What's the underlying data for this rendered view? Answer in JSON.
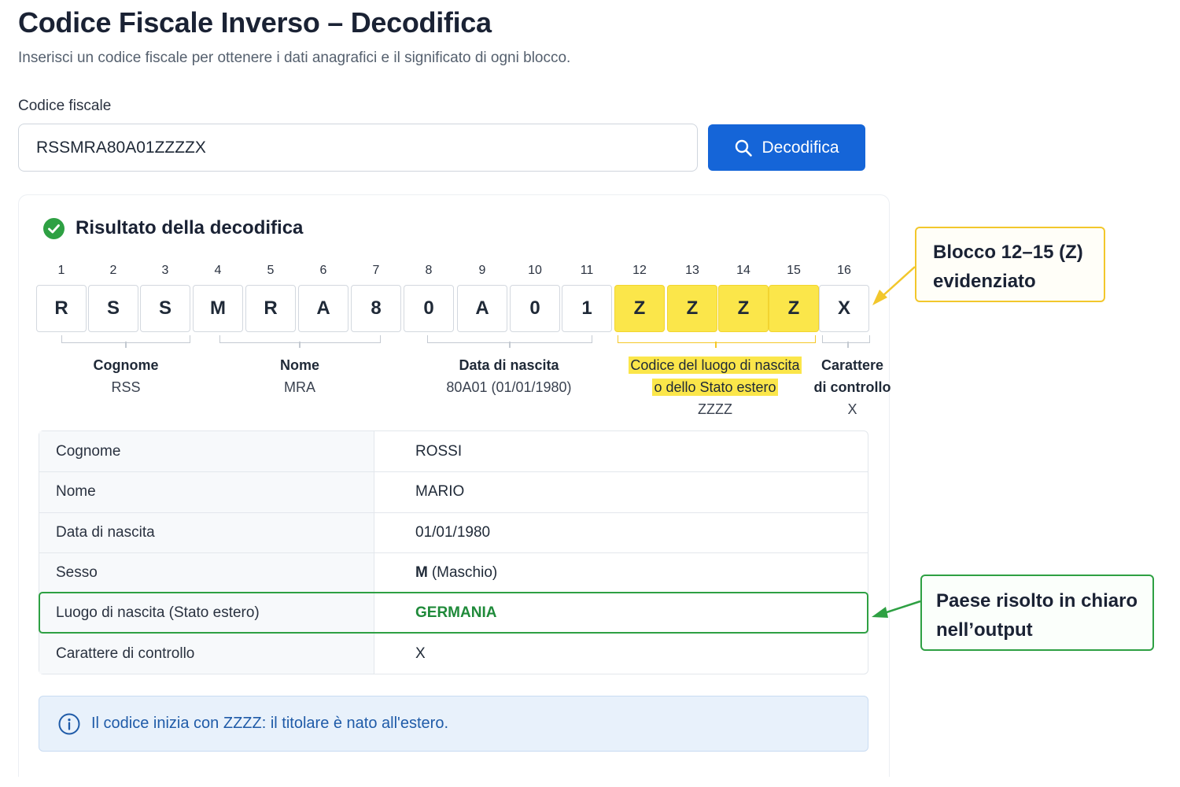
{
  "page": {
    "title": "Codice Fiscale Inverso – Decodifica",
    "subtitle": "Inserisci un codice fiscale per ottenere i dati anagrafici e il significato di ogni blocco."
  },
  "form": {
    "label": "Codice fiscale",
    "value": "RSSMRA80A01ZZZZX",
    "button_label": "Decodifica"
  },
  "result": {
    "title": "Risultato della decodifica",
    "characters": [
      {
        "pos": "1",
        "char": "R"
      },
      {
        "pos": "2",
        "char": "S"
      },
      {
        "pos": "3",
        "char": "S"
      },
      {
        "pos": "4",
        "char": "M"
      },
      {
        "pos": "5",
        "char": "R"
      },
      {
        "pos": "6",
        "char": "A"
      },
      {
        "pos": "7",
        "char": "8"
      },
      {
        "pos": "8",
        "char": "0"
      },
      {
        "pos": "9",
        "char": "A"
      },
      {
        "pos": "10",
        "char": "0"
      },
      {
        "pos": "11",
        "char": "1"
      },
      {
        "pos": "12",
        "char": "Z"
      },
      {
        "pos": "13",
        "char": "Z"
      },
      {
        "pos": "14",
        "char": "Z"
      },
      {
        "pos": "15",
        "char": "Z"
      },
      {
        "pos": "16",
        "char": "X"
      }
    ],
    "highlighted_positions": [
      "12",
      "13",
      "14",
      "15"
    ],
    "groups": [
      {
        "label": "Cognome",
        "value": "RSS"
      },
      {
        "label": "Nome",
        "value": "MRA"
      },
      {
        "label": "Data di nascita",
        "value": "80A01 (01/01/1980)"
      },
      {
        "label_line1": "Codice del luogo di nascita",
        "label_line2": "o dello Stato estero",
        "value": "ZZZZ"
      },
      {
        "label_line1": "Carattere",
        "label_line2": "di controllo",
        "value": "X"
      }
    ],
    "table": [
      {
        "key": "Cognome",
        "value": "ROSSI"
      },
      {
        "key": "Nome",
        "value": "MARIO"
      },
      {
        "key": "Data di nascita",
        "value": "01/01/1980"
      },
      {
        "key": "Sesso",
        "value_bold": "M",
        "value": "(Maschio)"
      },
      {
        "key": "Luogo di nascita (Stato estero)",
        "value": "GERMANIA"
      },
      {
        "key": "Carattere di controllo",
        "value": "X"
      }
    ],
    "notice": "Il codice inizia con ZZZZ: il titolare è nato all'estero."
  },
  "annotations": {
    "block_callout_line1": "Blocco 12–15 (Z)",
    "block_callout_line2": "evidenziato",
    "country_callout_line1": "Paese risolto in chiaro",
    "country_callout_line2": "nell’output"
  },
  "colors": {
    "accent_blue": "#1565d8",
    "highlight_yellow": "#fbe64a",
    "success_green": "#2ea043",
    "notice_blue": "#1f5ba8"
  },
  "icons": {
    "button_icon": "search-icon",
    "result_icon": "check-circle-icon",
    "notice_icon": "info-icon"
  }
}
